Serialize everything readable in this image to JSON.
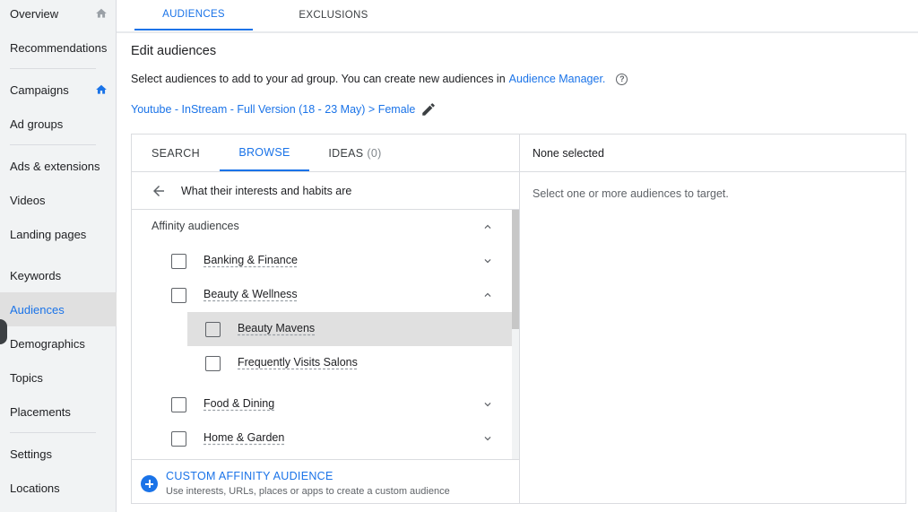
{
  "sidebar": {
    "items": [
      {
        "label": "Overview",
        "icon": "home-icon"
      },
      {
        "label": "Recommendations"
      },
      {
        "label": "Campaigns",
        "icon": "home-icon"
      },
      {
        "label": "Ad groups"
      },
      {
        "label": "Ads & extensions"
      },
      {
        "label": "Videos"
      },
      {
        "label": "Landing pages"
      },
      {
        "label": "Keywords"
      },
      {
        "label": "Audiences",
        "active": true
      },
      {
        "label": "Demographics"
      },
      {
        "label": "Topics"
      },
      {
        "label": "Placements"
      },
      {
        "label": "Settings"
      },
      {
        "label": "Locations"
      }
    ]
  },
  "top_tabs": {
    "audiences": "AUDIENCES",
    "exclusions": "EXCLUSIONS"
  },
  "main": {
    "title": "Edit audiences",
    "intro_text": "Select audiences to add to your ad group. You can create new audiences in",
    "intro_link": "Audience Manager.",
    "breadcrumb": "Youtube - InStream - Full Version (18 - 23 May) > Female"
  },
  "browser": {
    "tabs": {
      "search": "SEARCH",
      "browse": "BROWSE",
      "ideas": "IDEAS",
      "ideas_count": "(0)"
    },
    "back_text": "What their interests and habits are",
    "group": "Affinity audiences",
    "items": {
      "banking": "Banking & Finance",
      "beauty": "Beauty & Wellness",
      "beauty_mavens": "Beauty Mavens",
      "salons": "Frequently Visits Salons",
      "food": "Food & Dining",
      "home": "Home & Garden"
    },
    "custom": {
      "title": "CUSTOM AFFINITY AUDIENCE",
      "subtitle": "Use interests, URLs, places or apps to create a custom audience"
    }
  },
  "selected_panel": {
    "header": "None selected",
    "empty": "Select one or more audiences to target."
  },
  "colors": {
    "accent": "#1a73e8",
    "sidebar_bg": "#f1f3f4",
    "hover_row": "#e0e0e0"
  }
}
